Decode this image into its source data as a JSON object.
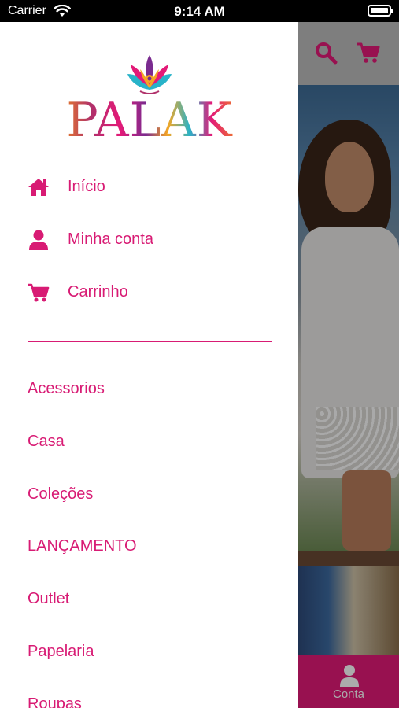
{
  "status_bar": {
    "carrier": "Carrier",
    "time": "9:14 AM"
  },
  "brand": {
    "logo_text": "PALAK",
    "accent_color": "#d81b74",
    "tabbar_color": "#e31a78"
  },
  "drawer": {
    "main_items": [
      {
        "label": "Início",
        "icon": "home-icon"
      },
      {
        "label": "Minha conta",
        "icon": "user-icon"
      },
      {
        "label": "Carrinho",
        "icon": "cart-icon"
      }
    ],
    "categories": [
      "Acessorios",
      "Casa",
      "Coleções",
      "LANÇAMENTO",
      "Outlet",
      "Papelaria",
      "Roupas"
    ]
  },
  "background": {
    "header_icons": [
      "search-icon",
      "cart-icon"
    ],
    "tabbar": {
      "label": "Conta",
      "icon": "user-icon"
    }
  }
}
